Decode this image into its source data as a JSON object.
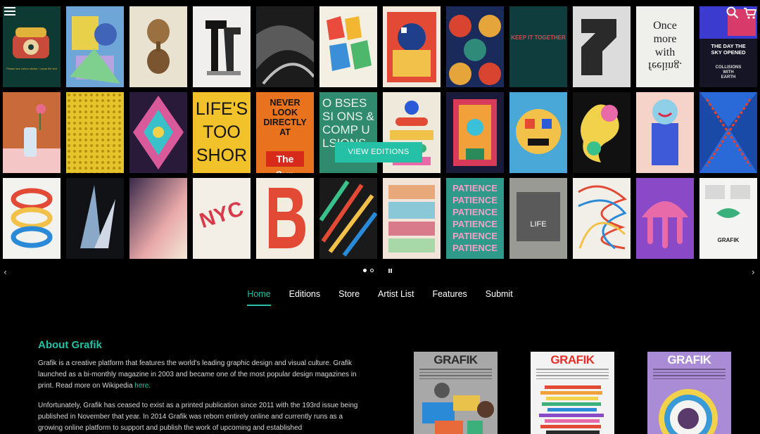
{
  "header": {
    "menu_icon": "hamburger-icon",
    "search_icon": "search-icon",
    "cart_icon": "cart-icon"
  },
  "carousel": {
    "cta_label": "VIEW EDITIONS",
    "prev_icon": "chevron-left-icon",
    "next_icon": "chevron-right-icon",
    "dots": 2,
    "active_dot": 0,
    "posters": {
      "p_telephone": "Please see colour sticker / visual file text",
      "p_life_line1": "LIFE'S",
      "p_life_line2": "TOO",
      "p_life_line3": "SHOR",
      "p_never_line1": "NEVER",
      "p_never_line2": "LOOK",
      "p_never_line3": "DIRECTLY",
      "p_never_line4": "AT",
      "p_never_brand": "The Sun",
      "p_once_line1": "Once",
      "p_once_line2": "more",
      "p_once_line3": "with",
      "p_once_line4": "feeling.",
      "p_day_line1": "THE DAY THE",
      "p_day_line2": "SKY OPENED",
      "p_day_line3": "COLLISIONS",
      "p_day_line4": "WITH",
      "p_day_line5": "EARTH",
      "p_obsessions": "O BSESSI ONS & COMP ULSIONS",
      "p_patience": "PATIENCE",
      "p_nyc": "NYC",
      "p_keep": "KEEP IT TOGETHER",
      "p_life_small": "LIFE",
      "p_grafik_small": "GRAFIK"
    }
  },
  "nav": {
    "items": [
      {
        "label": "Home",
        "active": true
      },
      {
        "label": "Editions",
        "active": false
      },
      {
        "label": "Store",
        "active": false
      },
      {
        "label": "Artist List",
        "active": false
      },
      {
        "label": "Features",
        "active": false
      },
      {
        "label": "Submit",
        "active": false
      }
    ]
  },
  "about": {
    "title": "About Grafik",
    "p1_text": "Grafik is a creative platform that features the world's leading graphic design and visual culture. Grafik launched as a bi-monthly magazine in 2003 and became one of the most popular design magazines in print. Read more on Wikipedia ",
    "p1_link": "here.",
    "p2_text": "Unfortunately, Grafik has ceased to exist as a printed publication since 2011 with the 193rd issue being published in November that year. In 2014 Grafik was reborn entirely online and currently runs as a growing online platform to support and publish the work of upcoming and established"
  },
  "covers": [
    {
      "logo": "GRAFIK",
      "bg": "#a8a8a8",
      "logo_color": "#2b2b2b"
    },
    {
      "logo": "GRAFIK",
      "bg": "#f3f3f3",
      "logo_color": "#e2302a"
    },
    {
      "logo": "GRAFIK",
      "bg": "#a98bd6",
      "logo_color": "#ffffff"
    }
  ],
  "colors": {
    "accent": "#24c1a6",
    "background": "#000000"
  }
}
